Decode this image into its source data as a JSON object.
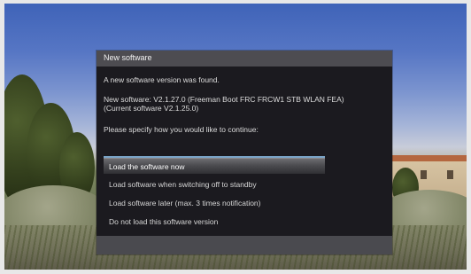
{
  "dialog": {
    "title": "New software",
    "message_found": "A new software version was found.",
    "message_version": "New software: V2.1.27.0 (Freeman Boot FRC FRCW1 STB WLAN FEA)",
    "message_current": "(Current software V2.1.25.0)",
    "prompt": "Please specify how you would like to continue:",
    "options": [
      {
        "label": "Load the software now",
        "selected": true
      },
      {
        "label": "Load software when switching off to standby",
        "selected": false
      },
      {
        "label": "Load software later (max. 3 times notification)",
        "selected": false
      },
      {
        "label": "Do not load this software version",
        "selected": false
      }
    ]
  },
  "colors": {
    "dialog_background": "#1b1a1f",
    "title_bar": "#4d4c51",
    "selection_accent": "#7aa4c8"
  }
}
